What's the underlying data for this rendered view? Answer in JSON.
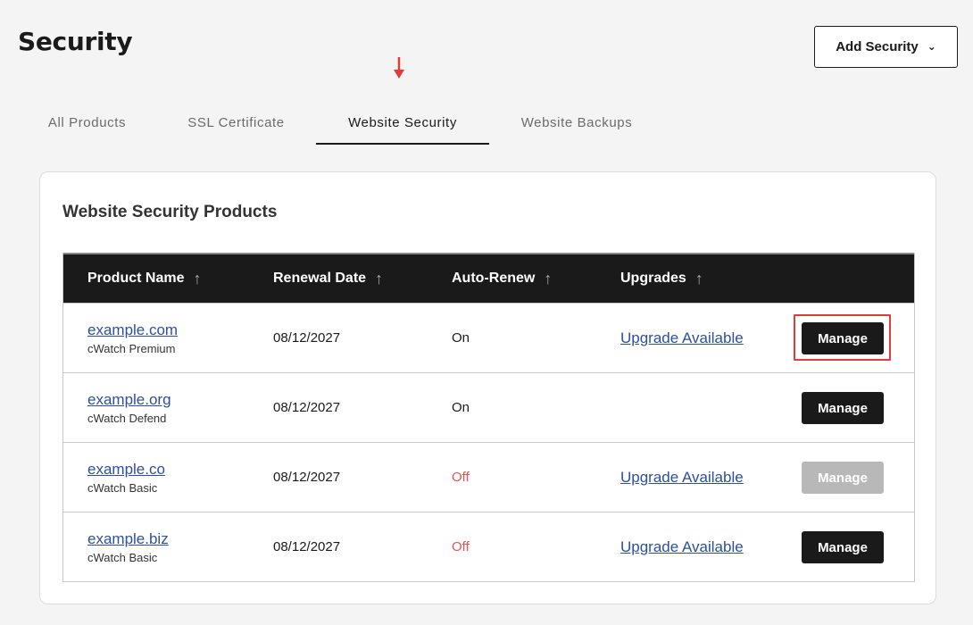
{
  "page": {
    "title": "Security"
  },
  "header": {
    "add_security_label": "Add Security",
    "add_security_icon": "chevron-down-icon"
  },
  "tabs": [
    {
      "label": "All Products",
      "active": false
    },
    {
      "label": "SSL Certificate",
      "active": false
    },
    {
      "label": "Website Security",
      "active": true
    },
    {
      "label": "Website Backups",
      "active": false
    }
  ],
  "card": {
    "title": "Website Security Products"
  },
  "table": {
    "columns": [
      {
        "label": "Product Name",
        "sort_icon": "arrow-up-icon"
      },
      {
        "label": "Renewal Date",
        "sort_icon": "arrow-up-icon"
      },
      {
        "label": "Auto-Renew",
        "sort_icon": "arrow-up-icon"
      },
      {
        "label": "Upgrades",
        "sort_icon": "arrow-up-icon"
      }
    ],
    "rows": [
      {
        "product": "example.com",
        "plan": "cWatch Premium",
        "renewal": "08/12/2027",
        "auto_renew": "On",
        "upgrade": "Upgrade Available",
        "action": "Manage",
        "action_enabled": true
      },
      {
        "product": "example.org",
        "plan": "cWatch Defend",
        "renewal": "08/12/2027",
        "auto_renew": "On",
        "upgrade": "",
        "action": "Manage",
        "action_enabled": true
      },
      {
        "product": "example.co",
        "plan": "cWatch Basic",
        "renewal": "08/12/2027",
        "auto_renew": "Off",
        "upgrade": "Upgrade Available",
        "action": "Manage",
        "action_enabled": false
      },
      {
        "product": "example.biz",
        "plan": "cWatch Basic",
        "renewal": "08/12/2027",
        "auto_renew": "Off",
        "upgrade": "Upgrade Available",
        "action": "Manage",
        "action_enabled": true
      }
    ]
  },
  "colors": {
    "accent": "#1a1a1a",
    "link": "#2d4fa0",
    "off": "#e05555",
    "annotation": "#e23b3b",
    "disabled": "#b8b8b8"
  }
}
